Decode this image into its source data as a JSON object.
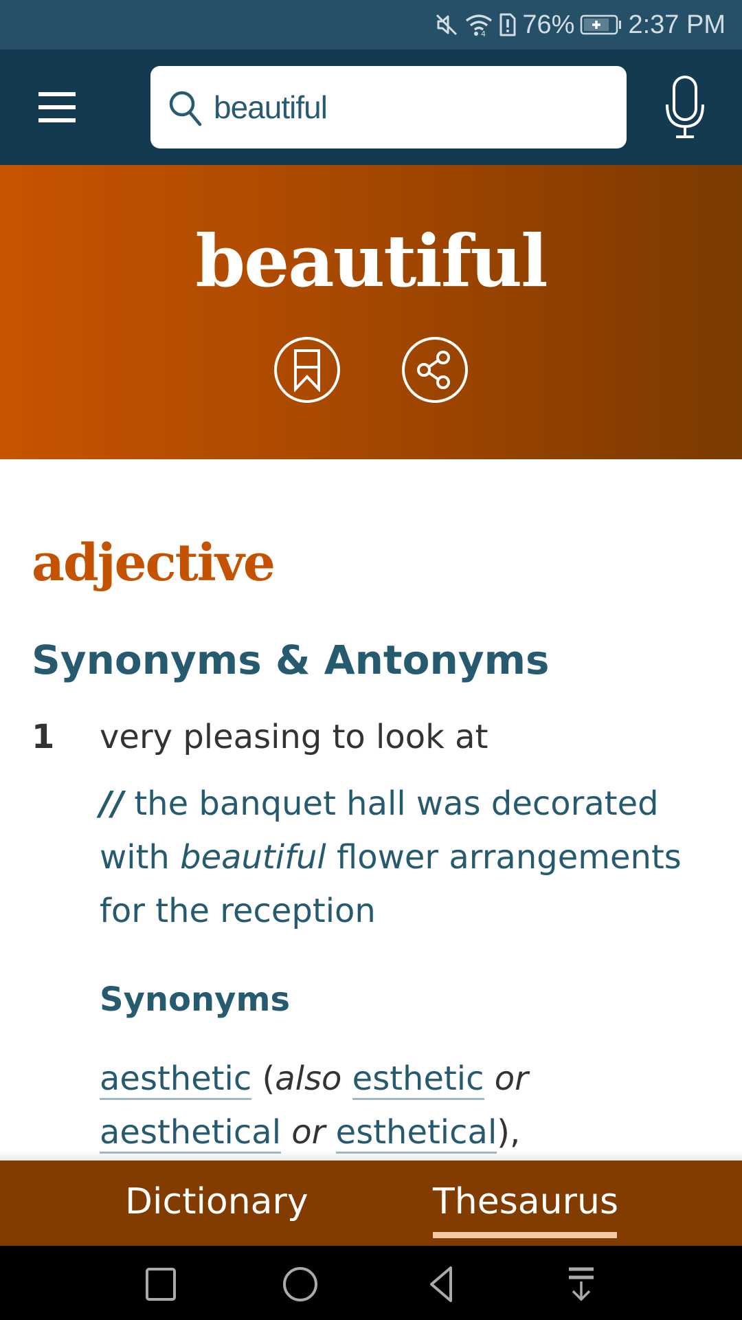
{
  "status_bar": {
    "battery_percent": "76%",
    "time": "2:37 PM",
    "icons": [
      "mute-icon",
      "wifi-icon",
      "sim-alert-icon",
      "battery-charging-icon"
    ]
  },
  "header": {
    "menu_icon": "hamburger-menu-icon",
    "search": {
      "value": "beautiful",
      "icon": "search-icon"
    },
    "mic_icon": "microphone-icon"
  },
  "hero": {
    "word": "beautiful",
    "actions": [
      {
        "icon": "bookmark-icon",
        "label": "Save word"
      },
      {
        "icon": "share-icon",
        "label": "Share"
      }
    ]
  },
  "entry": {
    "part_of_speech": "adjective",
    "section_title": "Synonyms & Antonyms",
    "senses": [
      {
        "number": "1",
        "definition": "very pleasing to look at",
        "example": {
          "marker": "//",
          "before": " the banquet hall was decorated with ",
          "highlight": "beautiful",
          "after": " flower arrangements for the reception"
        },
        "synonyms_title": "Synonyms",
        "synonyms": {
          "first": "aesthetic",
          "also_label": "also",
          "variant1": "esthetic",
          "or1": "or",
          "variant2": "aesthetical",
          "or2": "or",
          "variant3": "esthetical",
          "trailing": "),"
        }
      }
    ]
  },
  "tabs": {
    "items": [
      {
        "label": "Dictionary",
        "active": false
      },
      {
        "label": "Thesaurus",
        "active": true
      }
    ],
    "active_underline_color": "#f2c9a6"
  },
  "nav_bar": {
    "buttons": [
      "recents-square-icon",
      "home-circle-icon",
      "back-triangle-icon",
      "notification-pull-down-icon"
    ]
  },
  "colors": {
    "status_bar": "#265068",
    "header": "#143a52",
    "hero_start": "#c65400",
    "hero_end": "#7c3b00",
    "accent_orange": "#c45200",
    "teal_text": "#265a6e",
    "tab_bar": "#823c00"
  }
}
